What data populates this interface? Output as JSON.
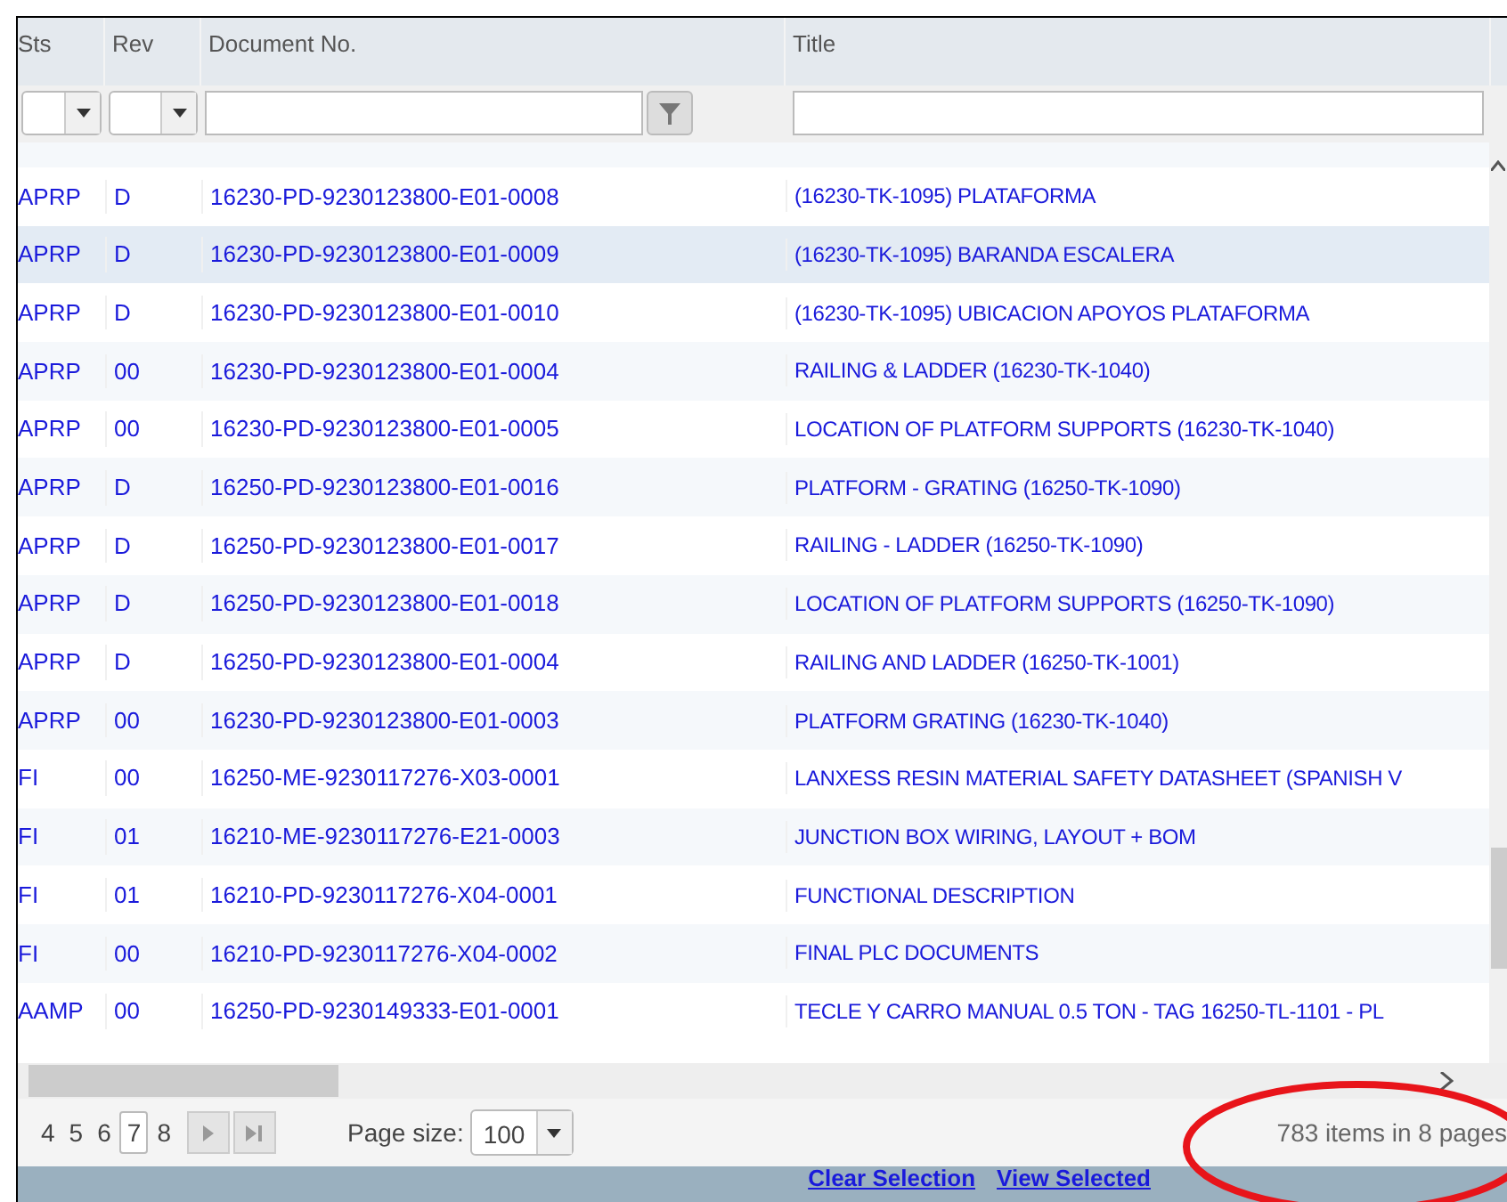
{
  "columns": [
    {
      "label": "Sts"
    },
    {
      "label": "Rev"
    },
    {
      "label": "Document No."
    },
    {
      "label": "Title"
    }
  ],
  "rows": [
    {
      "sts": "APRP",
      "rev": "D",
      "doc": "16230-PD-9230123800-E01-0008",
      "title": "(16230-TK-1095) PLATAFORMA",
      "selected": false
    },
    {
      "sts": "APRP",
      "rev": "D",
      "doc": "16230-PD-9230123800-E01-0009",
      "title": "(16230-TK-1095) BARANDA ESCALERA",
      "selected": true
    },
    {
      "sts": "APRP",
      "rev": "D",
      "doc": "16230-PD-9230123800-E01-0010",
      "title": "(16230-TK-1095) UBICACION APOYOS PLATAFORMA",
      "selected": false
    },
    {
      "sts": "APRP",
      "rev": "00",
      "doc": "16230-PD-9230123800-E01-0004",
      "title": "RAILING & LADDER (16230-TK-1040)",
      "selected": false
    },
    {
      "sts": "APRP",
      "rev": "00",
      "doc": "16230-PD-9230123800-E01-0005",
      "title": "LOCATION OF PLATFORM SUPPORTS (16230-TK-1040)",
      "selected": false
    },
    {
      "sts": "APRP",
      "rev": "D",
      "doc": "16250-PD-9230123800-E01-0016",
      "title": "PLATFORM - GRATING (16250-TK-1090)",
      "selected": false
    },
    {
      "sts": "APRP",
      "rev": "D",
      "doc": "16250-PD-9230123800-E01-0017",
      "title": "RAILING - LADDER (16250-TK-1090)",
      "selected": false
    },
    {
      "sts": "APRP",
      "rev": "D",
      "doc": "16250-PD-9230123800-E01-0018",
      "title": "LOCATION OF PLATFORM SUPPORTS (16250-TK-1090)",
      "selected": false
    },
    {
      "sts": "APRP",
      "rev": "D",
      "doc": "16250-PD-9230123800-E01-0004",
      "title": "RAILING AND LADDER (16250-TK-1001)",
      "selected": false
    },
    {
      "sts": "APRP",
      "rev": "00",
      "doc": "16230-PD-9230123800-E01-0003",
      "title": "PLATFORM GRATING (16230-TK-1040)",
      "selected": false
    },
    {
      "sts": "FI",
      "rev": "00",
      "doc": "16250-ME-9230117276-X03-0001",
      "title": "LANXESS RESIN MATERIAL SAFETY DATASHEET (SPANISH V",
      "selected": false
    },
    {
      "sts": "FI",
      "rev": "01",
      "doc": "16210-ME-9230117276-E21-0003",
      "title": "JUNCTION BOX WIRING, LAYOUT + BOM",
      "selected": false
    },
    {
      "sts": "FI",
      "rev": "01",
      "doc": "16210-PD-9230117276-X04-0001",
      "title": "FUNCTIONAL DESCRIPTION",
      "selected": false
    },
    {
      "sts": "FI",
      "rev": "00",
      "doc": "16210-PD-9230117276-X04-0002",
      "title": "FINAL PLC DOCUMENTS",
      "selected": false
    },
    {
      "sts": "AAMP",
      "rev": "00",
      "doc": "16250-PD-9230149333-E01-0001",
      "title": "TECLE Y CARRO MANUAL 0.5 TON - TAG 16250-TL-1101 - PL",
      "selected": false
    }
  ],
  "pager": {
    "pages": [
      {
        "label": "4",
        "selected": false
      },
      {
        "label": "5",
        "selected": false
      },
      {
        "label": "6",
        "selected": false
      },
      {
        "label": "7",
        "selected": true
      },
      {
        "label": "8",
        "selected": false
      }
    ],
    "page_size_label": "Page size:",
    "page_size": "100",
    "summary": "783 items in 8 pages"
  },
  "footer_links": [
    "Clear Selection",
    "View Selected"
  ]
}
